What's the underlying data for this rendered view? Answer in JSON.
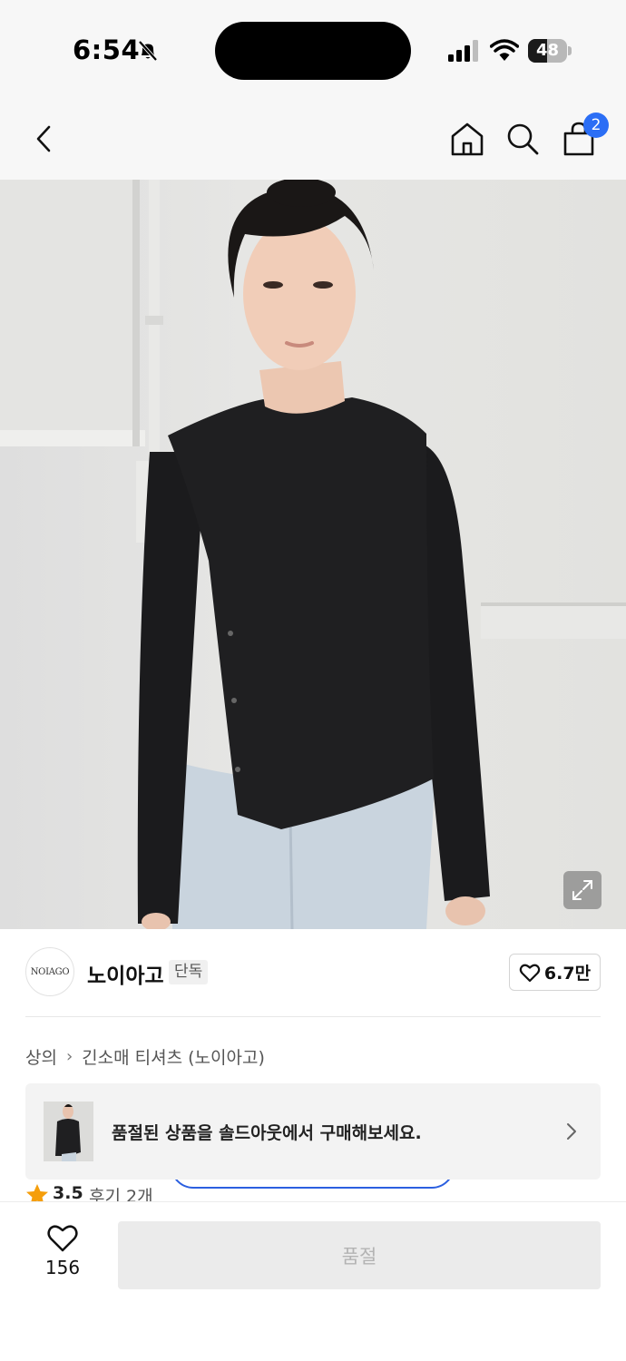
{
  "status_bar": {
    "time": "6:54",
    "battery_level": "48",
    "battery_fraction": 0.48,
    "icons": [
      "bell-slash-icon",
      "cellular-signal-icon",
      "wifi-icon",
      "battery-icon"
    ]
  },
  "header": {
    "icons": [
      "back-chevron-icon",
      "home-icon",
      "search-icon",
      "shopping-bag-icon"
    ],
    "cart_count": "2",
    "accent_color": "#2b6ef5"
  },
  "product_image": {
    "alt": "model wearing black long sleeve t-shirt with asymmetric button hem and light wash jeans"
  },
  "brand": {
    "logo_text": "NOIAGO",
    "name": "노이아고",
    "exclusive_badge": "단독",
    "likes": "6.7만"
  },
  "breadcrumb": {
    "items": [
      "상의",
      "긴소매 티셔츠 (노이아고)"
    ]
  },
  "soldout_banner": {
    "message": "품절된 상품을 솔드아웃에서 구매해보세요."
  },
  "rating": {
    "score": "3.5",
    "reviews": "후기 2개",
    "star_color": "#f59e0b"
  },
  "bottom_bar": {
    "wish_count": "156",
    "action_label": "품절"
  }
}
